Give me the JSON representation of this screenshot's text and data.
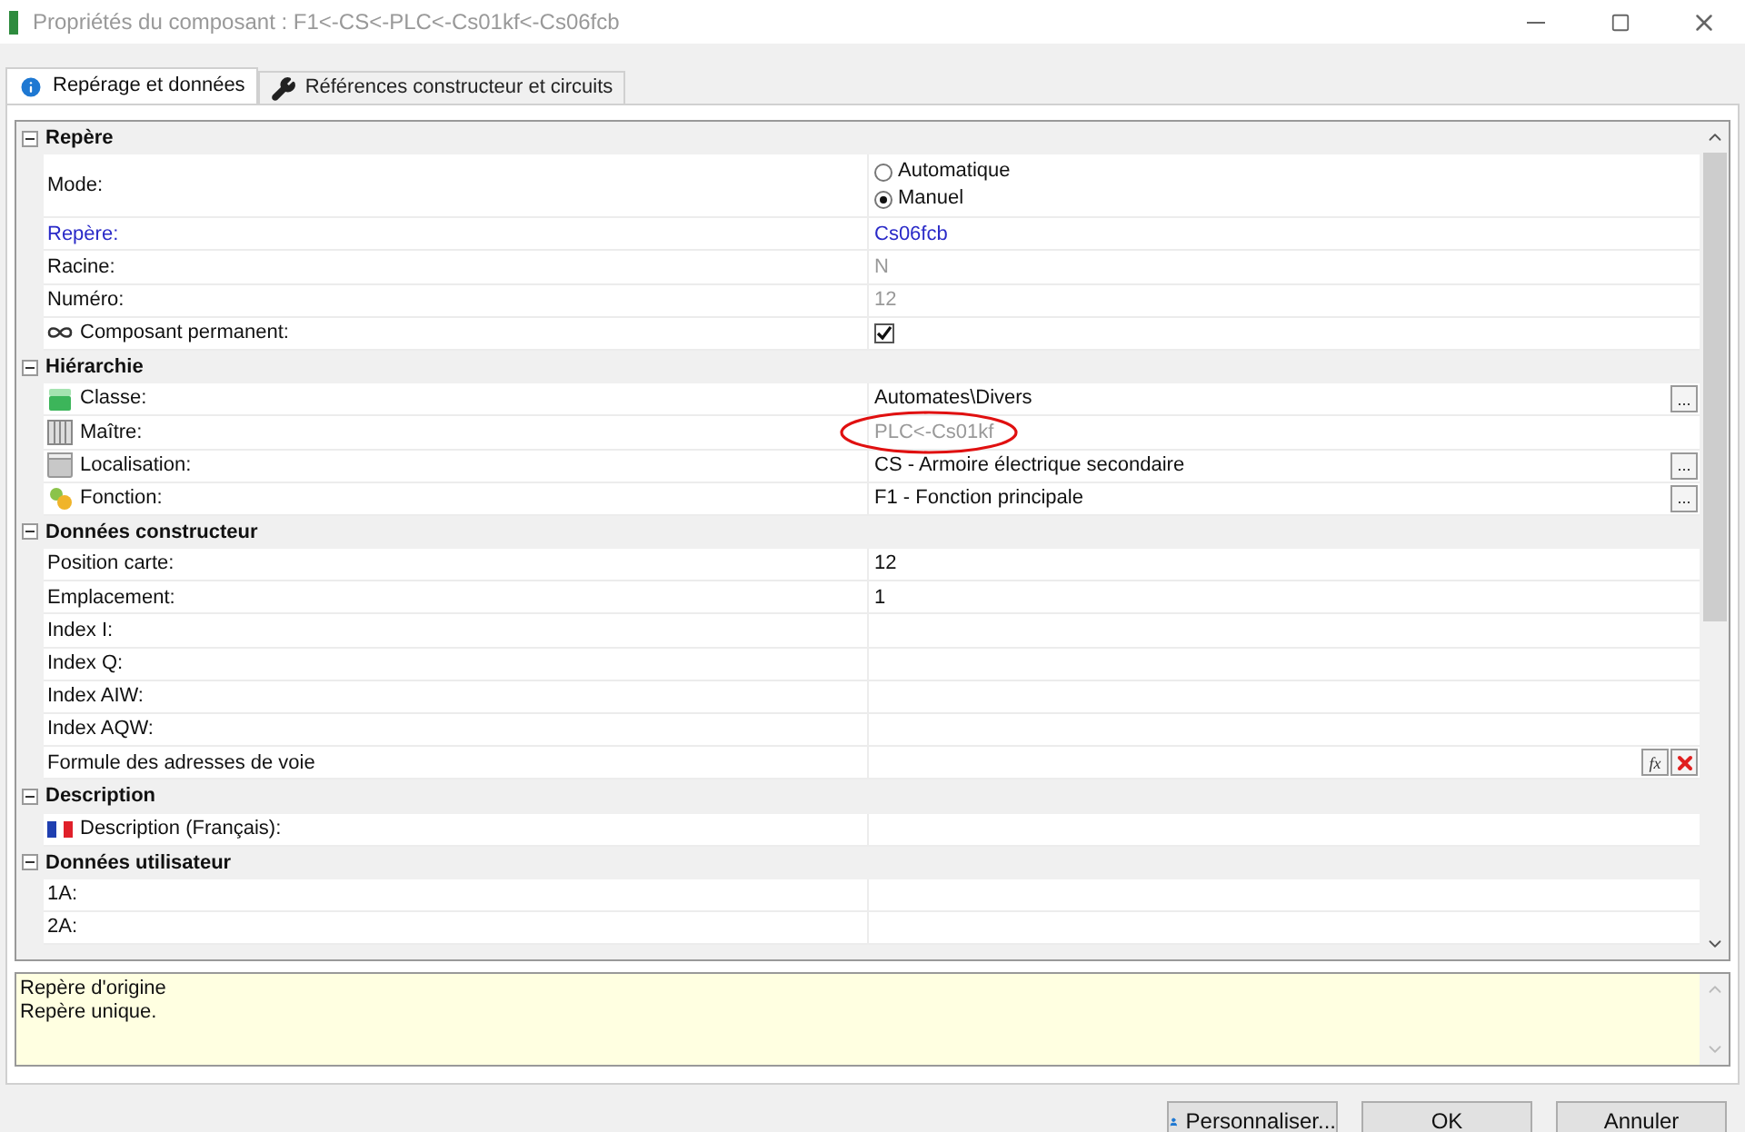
{
  "window": {
    "title": "Propriétés du composant : F1<-CS<-PLC<-Cs01kf<-Cs06fcb"
  },
  "tabs": [
    {
      "label": "Repérage et données",
      "selected": true
    },
    {
      "label": "Références constructeur et circuits",
      "selected": false
    }
  ],
  "sections": [
    {
      "title": "Repère",
      "expanded": true,
      "rows": [
        {
          "kind": "radio",
          "label": "Mode:",
          "options": [
            {
              "label": "Automatique",
              "selected": false
            },
            {
              "label": "Manuel",
              "selected": true
            }
          ]
        },
        {
          "kind": "text",
          "label": "Repère:",
          "highlighted": true,
          "value": "Cs06fcb",
          "dimmed": false
        },
        {
          "kind": "text",
          "label": "Racine:",
          "value": "N",
          "dimmed": true
        },
        {
          "kind": "text",
          "label": "Numéro:",
          "value": "12",
          "dimmed": true
        },
        {
          "kind": "checkbox",
          "label": "Composant permanent:",
          "checked": true
        }
      ]
    },
    {
      "title": "Hiérarchie",
      "expanded": true,
      "rows": [
        {
          "kind": "text",
          "label": "Classe:",
          "value": "Automates\\Divers",
          "dimmed": false,
          "button": "..."
        },
        {
          "kind": "text",
          "label": "Maître:",
          "value": "PLC<-Cs01kf",
          "dimmed": true,
          "circled": true
        },
        {
          "kind": "text",
          "label": "Localisation:",
          "value": "CS - Armoire électrique secondaire",
          "dimmed": false,
          "button": "..."
        },
        {
          "kind": "text",
          "label": "Fonction:",
          "value": "F1 - Fonction principale",
          "dimmed": false,
          "button": "..."
        }
      ]
    },
    {
      "title": "Données constructeur",
      "expanded": true,
      "rows": [
        {
          "kind": "text",
          "label": "Position carte:",
          "value": "12",
          "dimmed": false
        },
        {
          "kind": "text",
          "label": "Emplacement:",
          "value": "1",
          "dimmed": false
        },
        {
          "kind": "text",
          "label": "Index I:"
        },
        {
          "kind": "text",
          "label": "Index Q:"
        },
        {
          "kind": "text",
          "label": "Index AIW:"
        },
        {
          "kind": "text",
          "label": "Index AQW:"
        },
        {
          "kind": "formula",
          "label": "Formule des adresses de voie",
          "formula_button": "fx"
        }
      ]
    },
    {
      "title": "Description",
      "expanded": true,
      "rows": [
        {
          "kind": "text",
          "label": "Description (Français):"
        }
      ]
    },
    {
      "title": "Données utilisateur",
      "expanded": true,
      "rows": [
        {
          "kind": "text",
          "label": "1A:"
        },
        {
          "kind": "text",
          "label": "2A:"
        }
      ]
    }
  ],
  "help": {
    "title": "Repère d'origine",
    "text": "Repère unique."
  },
  "buttons": [
    {
      "label": "Personnaliser..."
    },
    {
      "label": "OK"
    },
    {
      "label": "Annuler"
    }
  ]
}
